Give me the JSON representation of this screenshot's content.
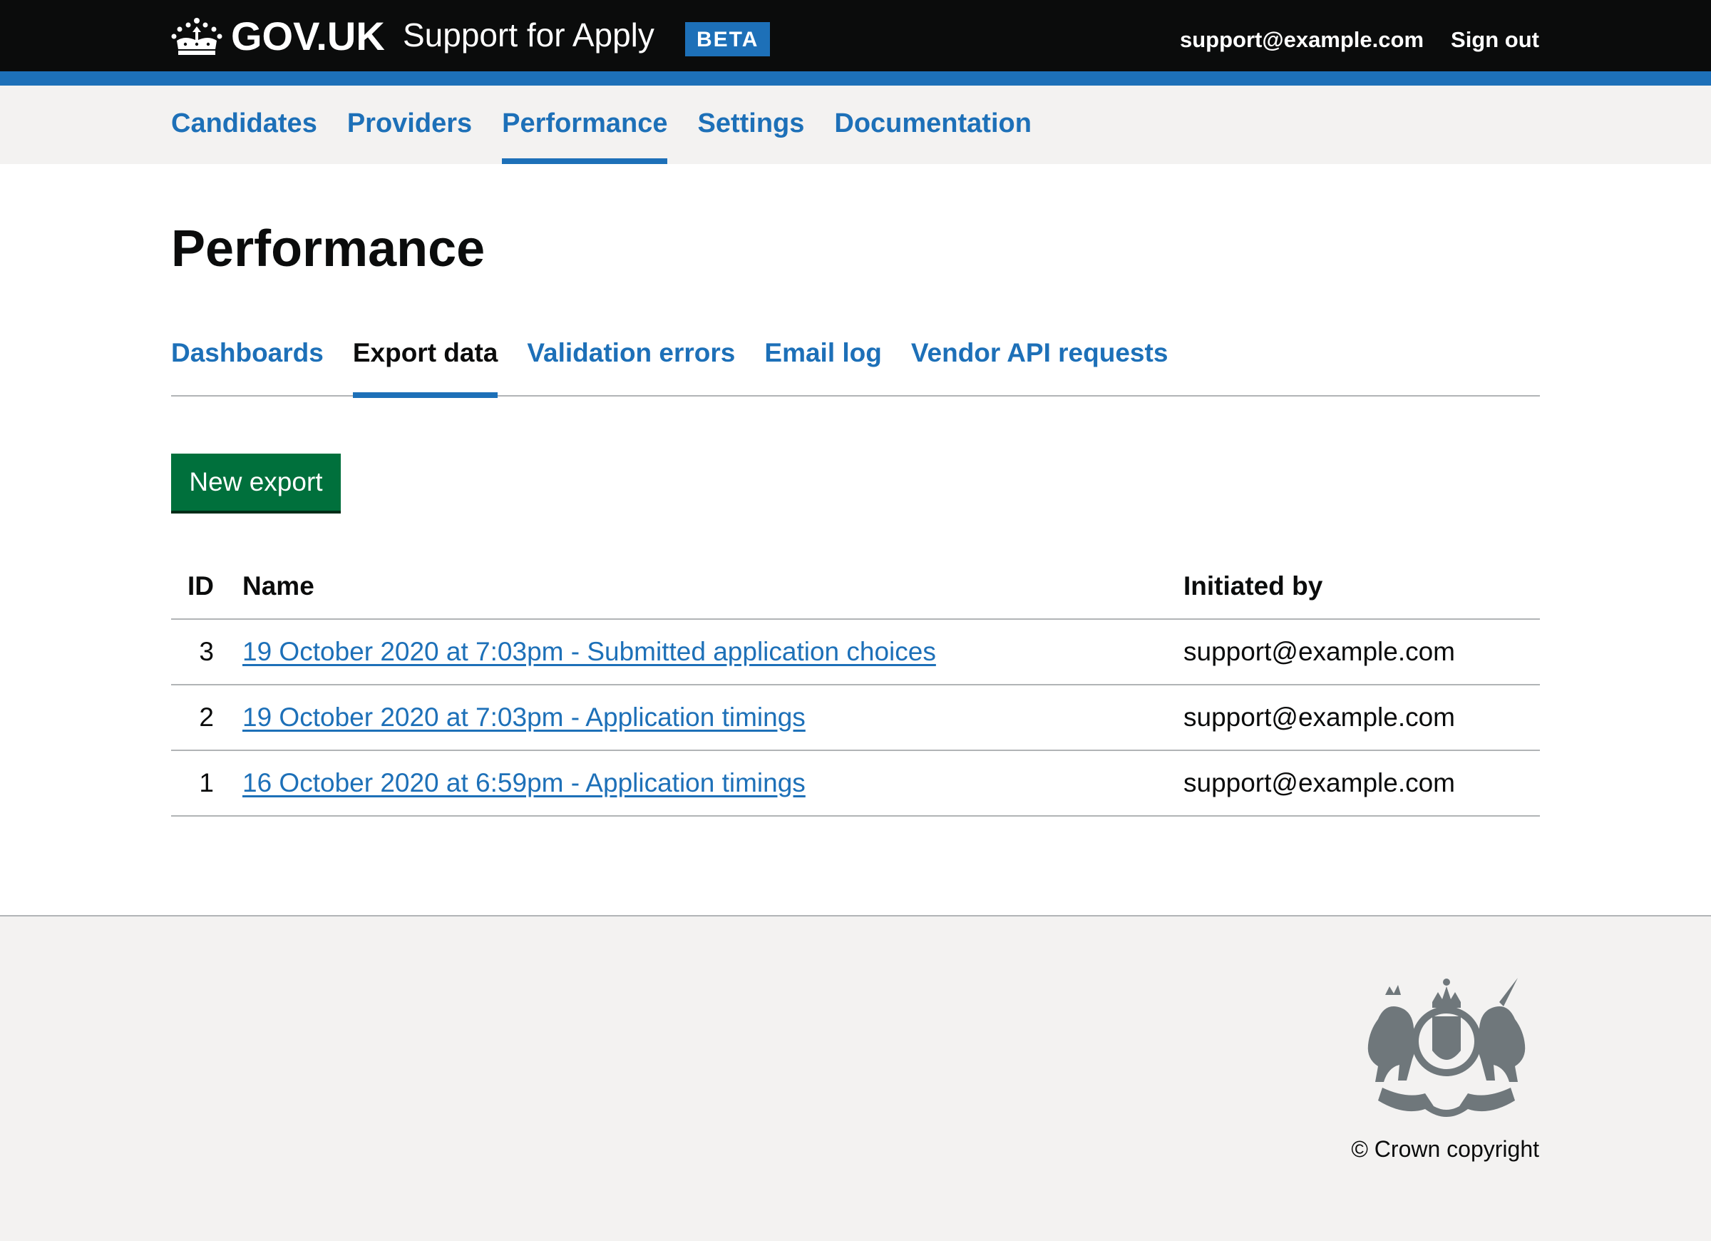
{
  "header": {
    "logo_text": "GOV.UK",
    "service_name": "Support for Apply",
    "phase_tag": "BETA",
    "user_email": "support@example.com",
    "sign_out": "Sign out"
  },
  "primary_nav": {
    "items": [
      {
        "label": "Candidates",
        "active": false
      },
      {
        "label": "Providers",
        "active": false
      },
      {
        "label": "Performance",
        "active": true
      },
      {
        "label": "Settings",
        "active": false
      },
      {
        "label": "Documentation",
        "active": false
      }
    ]
  },
  "main": {
    "title": "Performance",
    "sub_nav": [
      {
        "label": "Dashboards",
        "current": false
      },
      {
        "label": "Export data",
        "current": true
      },
      {
        "label": "Validation errors",
        "current": false
      },
      {
        "label": "Email log",
        "current": false
      },
      {
        "label": "Vendor API requests",
        "current": false
      }
    ],
    "new_export_button": "New export",
    "table": {
      "headers": {
        "id": "ID",
        "name": "Name",
        "initiated_by": "Initiated by"
      },
      "rows": [
        {
          "id": "3",
          "name": "19 October 2020 at 7:03pm - Submitted application choices",
          "initiated_by": "support@example.com"
        },
        {
          "id": "2",
          "name": "19 October 2020 at 7:03pm - Application timings",
          "initiated_by": "support@example.com"
        },
        {
          "id": "1",
          "name": "16 October 2020 at 6:59pm - Application timings",
          "initiated_by": "support@example.com"
        }
      ]
    }
  },
  "footer": {
    "copyright": "© Crown copyright",
    "crest_icon": "royal-coat-of-arms-icon"
  },
  "colors": {
    "header_bg": "#0b0c0c",
    "brand_blue": "#1d70b8",
    "button_green": "#00703c",
    "nav_bg": "#f3f2f1",
    "border": "#b1b4b6"
  }
}
